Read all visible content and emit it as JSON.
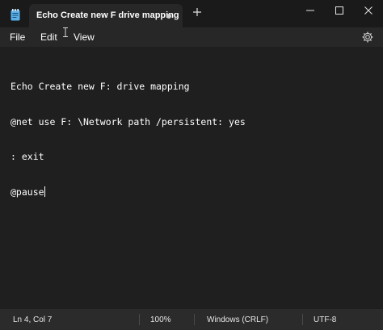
{
  "window": {
    "tab_title": "Echo Create new F drive mapping",
    "app_icon": "notepad-icon",
    "controls": [
      "minimize-icon",
      "maximize-icon",
      "close-icon"
    ]
  },
  "menu": {
    "file": "File",
    "edit": "Edit",
    "view": "View",
    "settings_icon": "gear-icon"
  },
  "editor": {
    "lines": [
      "Echo Create new F: drive mapping",
      "@net use F: \\Network path /persistent: yes",
      ": exit",
      "@pause"
    ]
  },
  "status": {
    "position": "Ln 4, Col 7",
    "zoom": "100%",
    "line_ending": "Windows (CRLF)",
    "encoding": "UTF-8"
  },
  "colors": {
    "titlebar": "#1a1a1a",
    "tab_active": "#272727",
    "editor_bg": "#1f1f1f",
    "statusbar": "#2b2b2b",
    "text": "#ffffff"
  }
}
